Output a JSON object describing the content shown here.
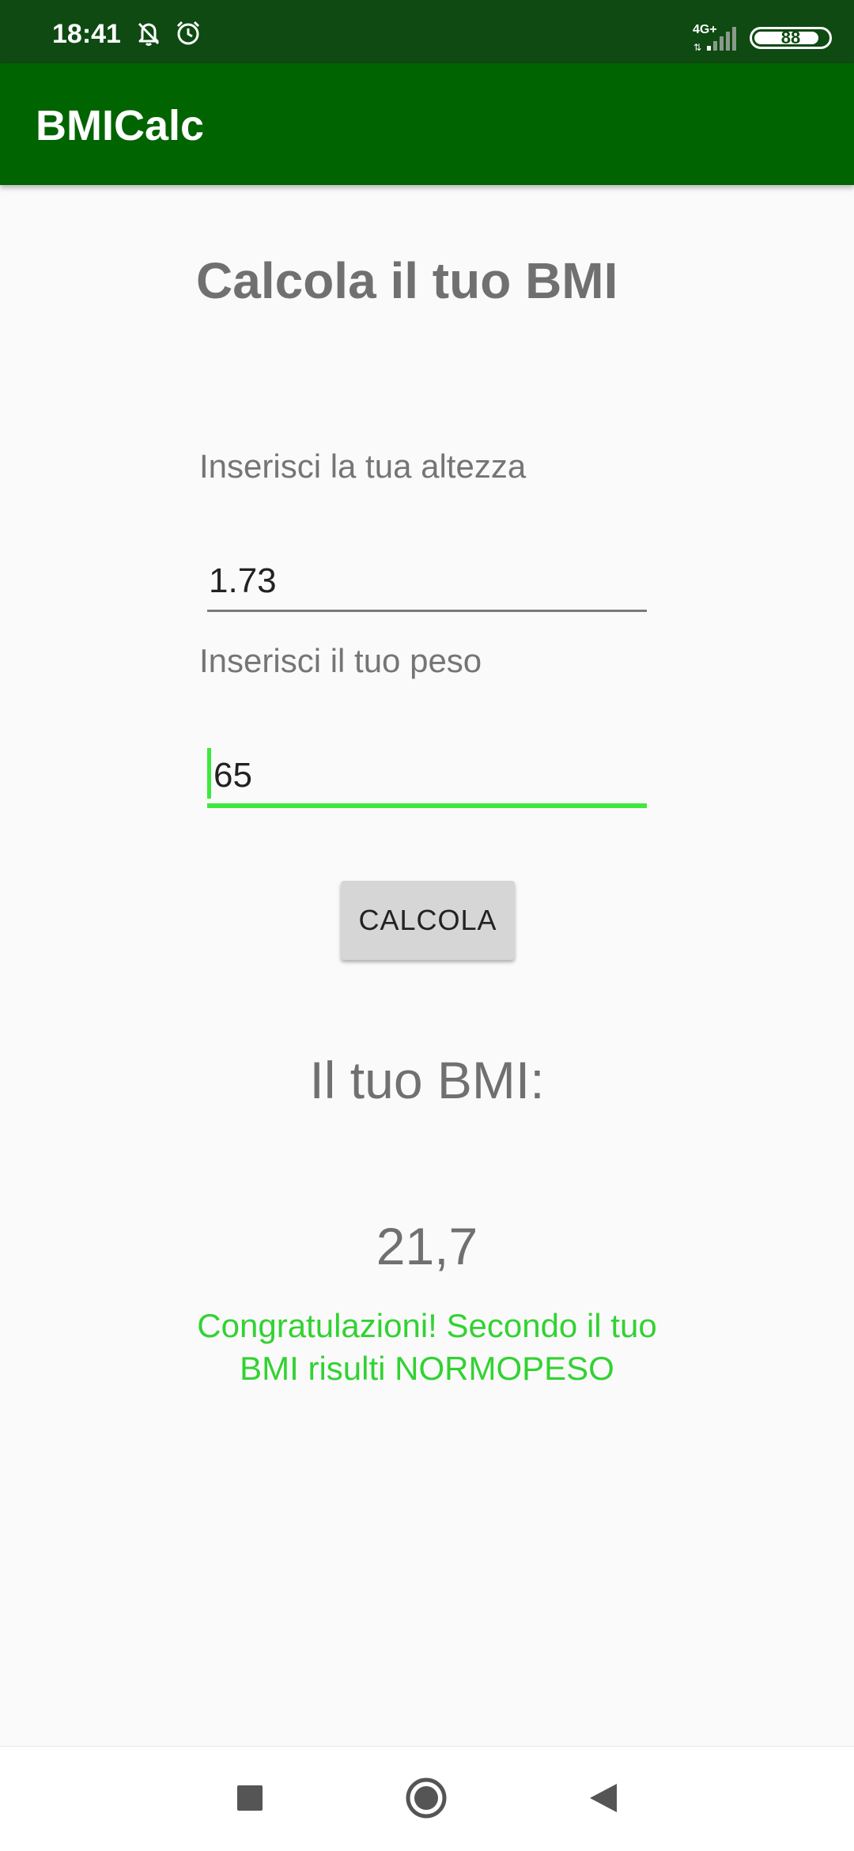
{
  "status_bar": {
    "time": "18:41",
    "network_label": "4G+",
    "battery_level": 88,
    "battery_text": "88",
    "icons": [
      "bell-muted-icon",
      "alarm-icon",
      "signal-icon",
      "battery-icon"
    ]
  },
  "app_bar": {
    "title": "BMICalc",
    "color": "#006400"
  },
  "main": {
    "heading": "Calcola il tuo BMI",
    "height_label": "Inserisci la tua altezza",
    "height_value": "1.73",
    "weight_label": "Inserisci il tuo peso",
    "weight_value": "65",
    "calculate_button": "CALCOLA",
    "result_heading": "Il tuo BMI:",
    "result_value": "21,7",
    "result_message": "Congratulazioni! Secondo il tuo BMI risulti NORMOPESO",
    "accent_color": "#3ee83e",
    "message_color": "#32d232"
  },
  "nav_bar": {
    "icons": [
      "recents-icon",
      "home-icon",
      "back-icon"
    ]
  }
}
